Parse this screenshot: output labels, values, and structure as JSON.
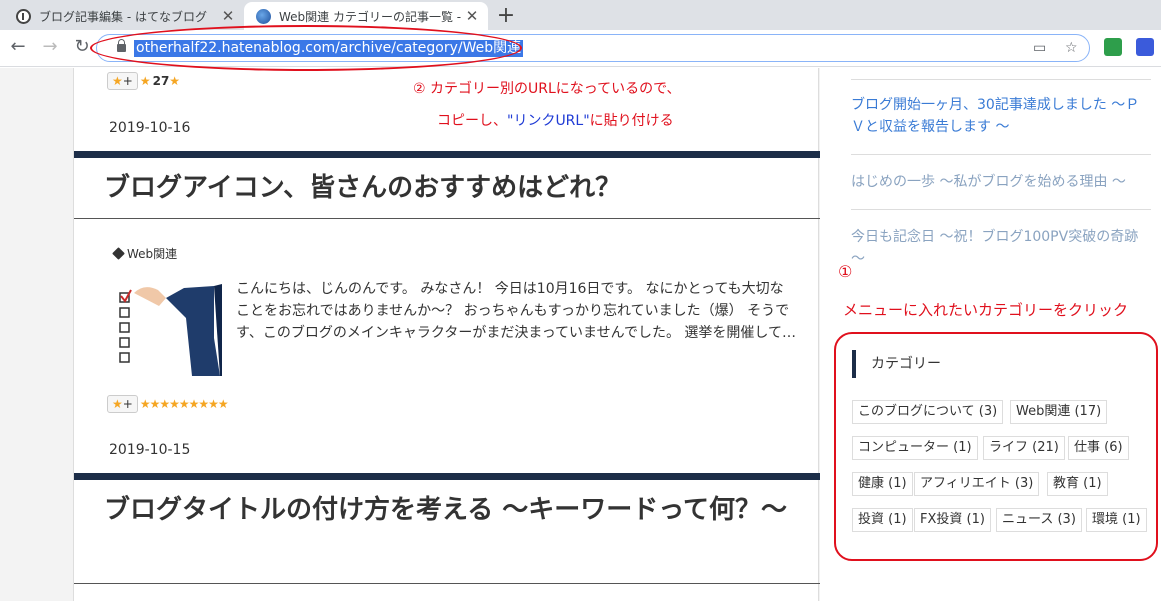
{
  "browser": {
    "tabs": [
      {
        "title": "ブログ記事編集 - はてなブログ"
      },
      {
        "title": "Web関連 カテゴリーの記事一覧 - Li"
      }
    ],
    "url": "otherhalf22.hatenablog.com/archive/category/Web関連"
  },
  "posts": [
    {
      "star_count": "27",
      "date": "2019-10-16"
    },
    {
      "title": "ブログアイコン、皆さんのおすすめはどれ？",
      "category": "Web関連",
      "excerpt": "こんにちは、じんのんです。 みなさん！ 今日は10月16日です。 なにかとっても大切なことをお忘れではありませんか～？ おっちゃんもすっかり忘れていました（爆） そうです、このブログのメインキャラクターがまだ決まっていませんでした。 選挙を開催して…",
      "stars": "★★★★★★★★★",
      "date": "2019-10-15"
    },
    {
      "title": "ブログタイトルの付け方を考える ～キーワードって何？～"
    }
  ],
  "sidebar": {
    "recent": [
      "ブログ開始一ヶ月、30記事達成しました ～ＰＶと収益を報告します ～",
      "はじめの一歩 ～私がブログを始める理由 ～",
      "今日も記念日 ～祝！ブログ100PV突破の奇跡～"
    ],
    "categories_title": "カテゴリー",
    "categories": [
      "このブログについて (3)",
      "Web関連 (17)",
      "コンピューター (1)",
      "ライフ (21)",
      "仕事 (6)",
      "健康 (1)",
      "アフィリエイト (3)",
      "教育 (1)",
      "投資 (1)",
      "FX投資 (1)",
      "ニュース (3)",
      "環境 (1)"
    ]
  },
  "annotations": {
    "step2_line1": "② カテゴリー別のURLになっているので、",
    "step2_line2a": "コピーし、",
    "step2_line2b": "\"リンクURL\"",
    "step2_line2c": "に貼り付ける",
    "step1_num": "①",
    "step1_text": "メニューに入れたいカテゴリーをクリック"
  },
  "colors": {
    "annotation": "#e0101d",
    "heading_bar": "#1c2d48",
    "link": "#3a7bd5"
  }
}
